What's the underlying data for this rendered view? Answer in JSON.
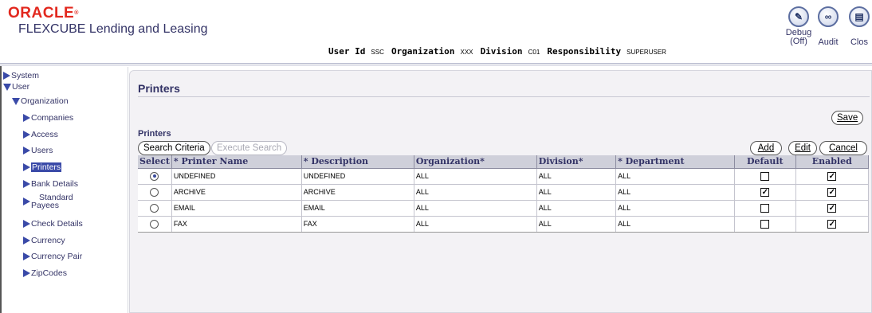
{
  "header": {
    "brand": "ORACLE",
    "brand_mark": "®",
    "product": "FLEXCUBE Lending and Leasing",
    "user_id_label": "User Id",
    "user_id": "SSC",
    "organization_label": "Organization",
    "organization": "XXX",
    "division_label": "Division",
    "division": "C01",
    "responsibility_label": "Responsibility",
    "responsibility": "SUPERUSER",
    "debug_label": "Debug",
    "debug_state": "(Off)",
    "audit_label": "Audit",
    "close_label": "Clos"
  },
  "sidebar": {
    "items": [
      {
        "label": "System",
        "icon": "triangle-right-icon"
      },
      {
        "label": "User",
        "icon": "triangle-down-icon"
      },
      {
        "label": "Organization",
        "icon": "triangle-down-icon"
      },
      {
        "label": "Companies",
        "icon": "triangle-right-icon"
      },
      {
        "label": "Access",
        "icon": "triangle-right-icon"
      },
      {
        "label": "Users",
        "icon": "triangle-right-icon"
      },
      {
        "label": "Printers",
        "icon": "triangle-right-icon",
        "selected": true
      },
      {
        "label": "Bank Details",
        "icon": "triangle-right-icon"
      },
      {
        "label": "Standard",
        "label2": "Payees",
        "icon": "triangle-right-icon"
      },
      {
        "label": "Check Details",
        "icon": "triangle-right-icon"
      },
      {
        "label": "Currency",
        "icon": "triangle-right-icon"
      },
      {
        "label": "Currency Pair",
        "icon": "triangle-right-icon"
      },
      {
        "label": "ZipCodes",
        "icon": "triangle-right-icon"
      }
    ]
  },
  "main": {
    "title": "Printers",
    "section_label": "Printers",
    "buttons": {
      "save": "Save",
      "search_criteria": "Search Criteria",
      "execute_search": "Execute Search",
      "add": "Add",
      "edit": "Edit",
      "cancel": "Cancel"
    },
    "table": {
      "headers": [
        "Select",
        "* Printer Name",
        "* Description",
        "Organization*",
        "Division*",
        "* Department",
        "Default",
        "Enabled"
      ],
      "rows": [
        {
          "selected": true,
          "name": "UNDEFINED",
          "description": "UNDEFINED",
          "organization": "ALL",
          "division": "ALL",
          "department": "ALL",
          "default": false,
          "enabled": true
        },
        {
          "selected": false,
          "name": "ARCHIVE",
          "description": "ARCHIVE",
          "organization": "ALL",
          "division": "ALL",
          "department": "ALL",
          "default": true,
          "enabled": true
        },
        {
          "selected": false,
          "name": "EMAIL",
          "description": "EMAIL",
          "organization": "ALL",
          "division": "ALL",
          "department": "ALL",
          "default": false,
          "enabled": true
        },
        {
          "selected": false,
          "name": "FAX",
          "description": "FAX",
          "organization": "ALL",
          "division": "ALL",
          "department": "ALL",
          "default": false,
          "enabled": true
        }
      ]
    }
  },
  "colors": {
    "brand_red": "#e2281e",
    "nav_blue": "#3a4aa8",
    "header_text": "#333366",
    "table_header_bg": "#cfd0da"
  }
}
